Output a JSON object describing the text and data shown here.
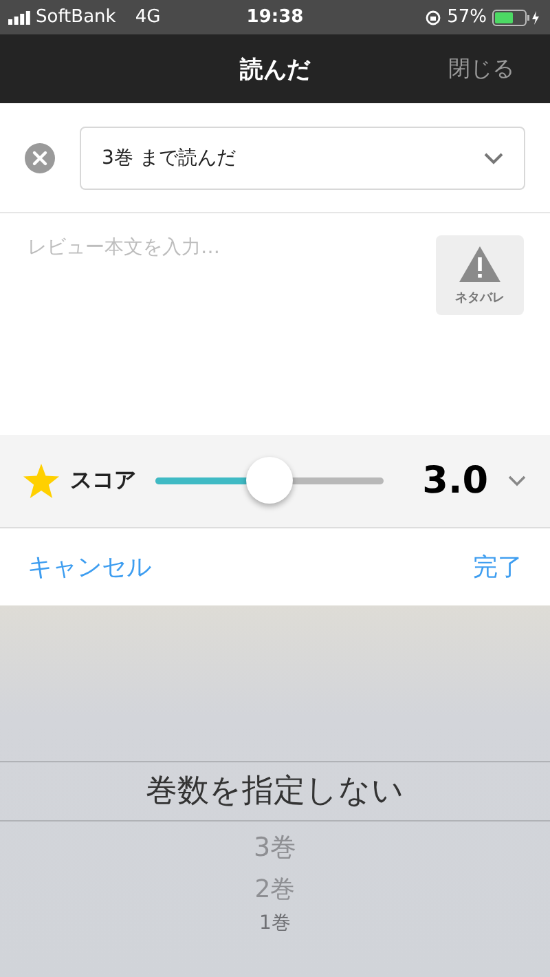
{
  "status_bar": {
    "carrier": "SoftBank",
    "network": "4G",
    "time": "19:38",
    "battery_percent": "57%"
  },
  "nav": {
    "title": "読んだ",
    "close": "閉じる"
  },
  "volume_select": {
    "value": "3巻 まで読んだ"
  },
  "review": {
    "placeholder": "レビュー本文を入力…",
    "spoiler_label": "ネタバレ",
    "spoiler_on": false
  },
  "score": {
    "label": "スコア",
    "level": 0.5,
    "value": "3.0"
  },
  "picker_toolbar": {
    "cancel": "キャンセル",
    "done": "完了"
  },
  "picker": [
    {
      "label": "巻数を指定しない",
      "selected": true
    },
    {
      "label": "3巻",
      "selected": false
    },
    {
      "label": "2巻",
      "selected": false
    },
    {
      "label": "1巻",
      "selected": false
    }
  ]
}
